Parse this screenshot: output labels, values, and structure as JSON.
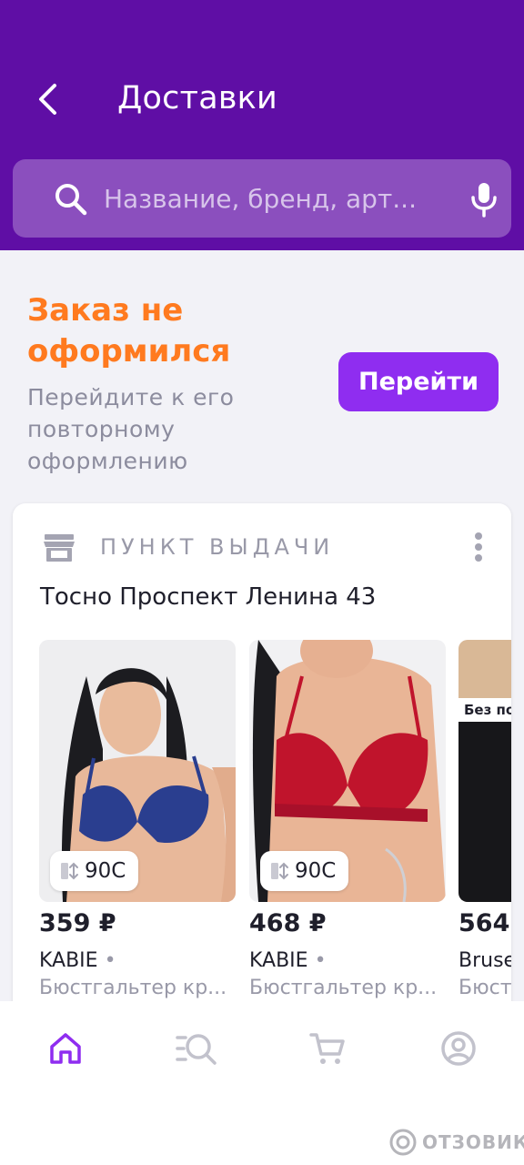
{
  "header": {
    "title": "Доставки",
    "back_icon": "chevron-left-icon",
    "color": "#5f0ea5"
  },
  "search": {
    "placeholder": "Название, бренд, арт...",
    "value": "",
    "search_icon": "search-icon",
    "mic_icon": "microphone-icon"
  },
  "notice": {
    "title": "Заказ не оформился",
    "text": "Перейдите к его повторному оформлению",
    "button_label": "Перейти",
    "title_color": "#ff7a1f",
    "button_color": "#8f2df0"
  },
  "pickup": {
    "label": "ПУНКТ ВЫДАЧИ",
    "address": "Тосно Проспект Ленина 43",
    "icon": "store-icon",
    "menu_icon": "more-vertical-icon"
  },
  "products": [
    {
      "size": "90C",
      "price": "359 ₽",
      "brand": "KABIE",
      "name": "Бюстгальтер кр...",
      "badge": ""
    },
    {
      "size": "90C",
      "price": "468 ₽",
      "brand": "KABIE",
      "name": "Бюстгальтер кр...",
      "badge": ""
    },
    {
      "size": "",
      "price": "564",
      "brand": "Bruse",
      "name": "Бюст",
      "badge": "Без по"
    }
  ],
  "bottom_nav": [
    {
      "icon": "home-icon",
      "active": true
    },
    {
      "icon": "catalog-search-icon",
      "active": false
    },
    {
      "icon": "cart-icon",
      "active": false
    },
    {
      "icon": "profile-icon",
      "active": false
    }
  ],
  "watermark": {
    "text": "ОТЗОВИК"
  }
}
